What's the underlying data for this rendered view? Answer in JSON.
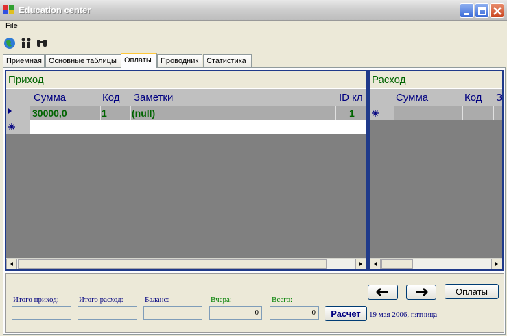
{
  "window": {
    "title": "Education center"
  },
  "menu": {
    "file": "File"
  },
  "toolbar": {
    "icons": [
      "globe-icon",
      "people-icon",
      "binoculars-icon"
    ]
  },
  "tabs": [
    {
      "label": "Приемная",
      "active": false
    },
    {
      "label": "Основные таблицы",
      "active": false
    },
    {
      "label": "Оплаты",
      "active": true
    },
    {
      "label": "Проводник",
      "active": false
    },
    {
      "label": "Статистика",
      "active": false
    }
  ],
  "income_grid": {
    "caption": "Приход",
    "columns": [
      "Сумма",
      "Код",
      "Заметки",
      "ID кл"
    ],
    "rows": [
      {
        "summa": "30000,0",
        "kod": "1",
        "zametki": "(null)",
        "id_kl": "1"
      }
    ]
  },
  "expense_grid": {
    "caption": "Расход",
    "columns": [
      "Сумма",
      "Код",
      "З"
    ]
  },
  "bottom": {
    "total_income_label": "Итого приход:",
    "total_expense_label": "Итого расход:",
    "balance_label": "Баланс:",
    "yesterday_label": "Вчера:",
    "total_label": "Всего:",
    "total_income_value": "",
    "total_expense_value": "",
    "balance_value": "",
    "yesterday_value": "0",
    "total_value": "0",
    "calc_button": "Расчет",
    "payments_button": "Оплаты",
    "date_text": "19 мая 2006, пятница"
  },
  "colors": {
    "accent": "#1F3A8A",
    "grid_text": "#006400",
    "header_text": "#000080"
  }
}
